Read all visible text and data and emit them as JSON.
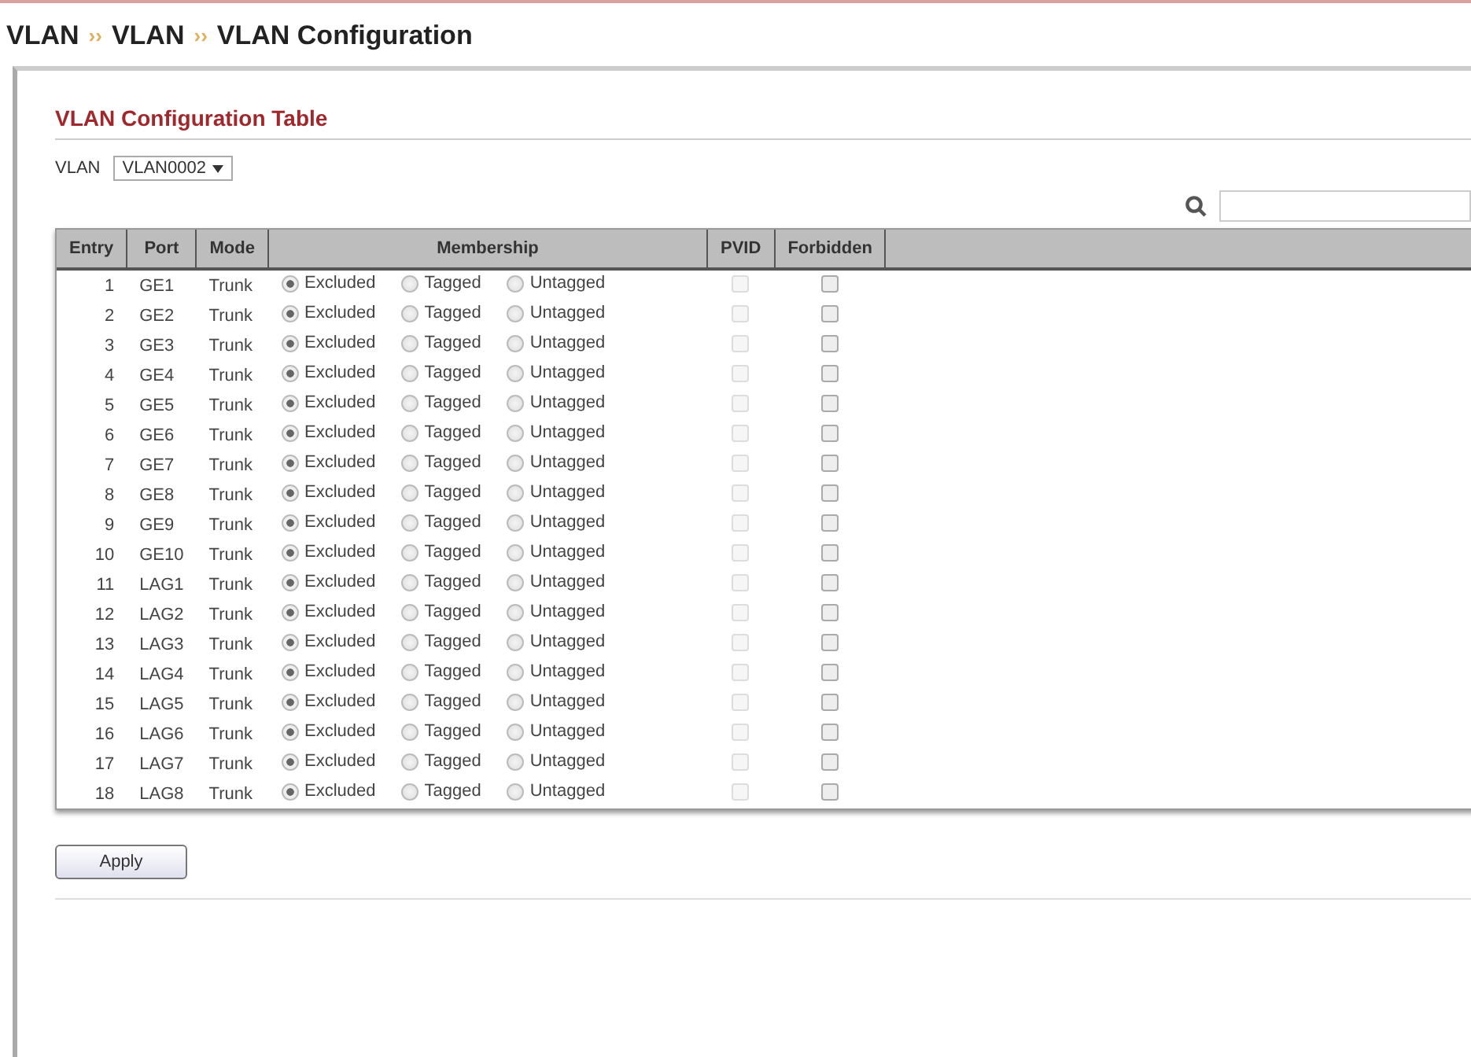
{
  "breadcrumb": [
    "VLAN",
    "VLAN",
    "VLAN Configuration"
  ],
  "breadcrumb_separator": "››",
  "section_title": "VLAN Configuration Table",
  "vlan_select": {
    "label": "VLAN",
    "value": "VLAN0002"
  },
  "table": {
    "columns": [
      "Entry",
      "Port",
      "Mode",
      "Membership",
      "PVID",
      "Forbidden"
    ],
    "rows": [
      {
        "entry": "1",
        "port": "GE1",
        "mode": "Trunk",
        "membership": [
          {
            "label": "Excluded",
            "selected": true
          },
          {
            "label": "Tagged",
            "selected": false
          },
          {
            "label": "Untagged",
            "selected": false
          }
        ],
        "pvid": {
          "checked": false,
          "disabled": true
        },
        "forbidden": {
          "checked": false
        }
      },
      {
        "entry": "2",
        "port": "GE2",
        "mode": "Trunk",
        "membership": [
          {
            "label": "Excluded",
            "selected": true
          },
          {
            "label": "Tagged",
            "selected": false
          },
          {
            "label": "Untagged",
            "selected": false
          }
        ],
        "pvid": {
          "checked": false,
          "disabled": true
        },
        "forbidden": {
          "checked": false
        }
      },
      {
        "entry": "3",
        "port": "GE3",
        "mode": "Trunk",
        "membership": [
          {
            "label": "Excluded",
            "selected": true
          },
          {
            "label": "Tagged",
            "selected": false
          },
          {
            "label": "Untagged",
            "selected": false
          }
        ],
        "pvid": {
          "checked": false,
          "disabled": true
        },
        "forbidden": {
          "checked": false
        }
      },
      {
        "entry": "4",
        "port": "GE4",
        "mode": "Trunk",
        "membership": [
          {
            "label": "Excluded",
            "selected": true
          },
          {
            "label": "Tagged",
            "selected": false
          },
          {
            "label": "Untagged",
            "selected": false
          }
        ],
        "pvid": {
          "checked": false,
          "disabled": true
        },
        "forbidden": {
          "checked": false
        }
      },
      {
        "entry": "5",
        "port": "GE5",
        "mode": "Trunk",
        "membership": [
          {
            "label": "Excluded",
            "selected": true
          },
          {
            "label": "Tagged",
            "selected": false
          },
          {
            "label": "Untagged",
            "selected": false
          }
        ],
        "pvid": {
          "checked": false,
          "disabled": true
        },
        "forbidden": {
          "checked": false
        }
      },
      {
        "entry": "6",
        "port": "GE6",
        "mode": "Trunk",
        "membership": [
          {
            "label": "Excluded",
            "selected": true
          },
          {
            "label": "Tagged",
            "selected": false
          },
          {
            "label": "Untagged",
            "selected": false
          }
        ],
        "pvid": {
          "checked": false,
          "disabled": true
        },
        "forbidden": {
          "checked": false
        }
      },
      {
        "entry": "7",
        "port": "GE7",
        "mode": "Trunk",
        "membership": [
          {
            "label": "Excluded",
            "selected": true
          },
          {
            "label": "Tagged",
            "selected": false
          },
          {
            "label": "Untagged",
            "selected": false
          }
        ],
        "pvid": {
          "checked": false,
          "disabled": true
        },
        "forbidden": {
          "checked": false
        }
      },
      {
        "entry": "8",
        "port": "GE8",
        "mode": "Trunk",
        "membership": [
          {
            "label": "Excluded",
            "selected": true
          },
          {
            "label": "Tagged",
            "selected": false
          },
          {
            "label": "Untagged",
            "selected": false
          }
        ],
        "pvid": {
          "checked": false,
          "disabled": true
        },
        "forbidden": {
          "checked": false
        }
      },
      {
        "entry": "9",
        "port": "GE9",
        "mode": "Trunk",
        "membership": [
          {
            "label": "Excluded",
            "selected": true
          },
          {
            "label": "Tagged",
            "selected": false
          },
          {
            "label": "Untagged",
            "selected": false
          }
        ],
        "pvid": {
          "checked": false,
          "disabled": true
        },
        "forbidden": {
          "checked": false
        }
      },
      {
        "entry": "10",
        "port": "GE10",
        "mode": "Trunk",
        "membership": [
          {
            "label": "Excluded",
            "selected": true
          },
          {
            "label": "Tagged",
            "selected": false
          },
          {
            "label": "Untagged",
            "selected": false
          }
        ],
        "pvid": {
          "checked": false,
          "disabled": true
        },
        "forbidden": {
          "checked": false
        }
      },
      {
        "entry": "11",
        "port": "LAG1",
        "mode": "Trunk",
        "membership": [
          {
            "label": "Excluded",
            "selected": true
          },
          {
            "label": "Tagged",
            "selected": false
          },
          {
            "label": "Untagged",
            "selected": false
          }
        ],
        "pvid": {
          "checked": false,
          "disabled": true
        },
        "forbidden": {
          "checked": false
        }
      },
      {
        "entry": "12",
        "port": "LAG2",
        "mode": "Trunk",
        "membership": [
          {
            "label": "Excluded",
            "selected": true
          },
          {
            "label": "Tagged",
            "selected": false
          },
          {
            "label": "Untagged",
            "selected": false
          }
        ],
        "pvid": {
          "checked": false,
          "disabled": true
        },
        "forbidden": {
          "checked": false
        }
      },
      {
        "entry": "13",
        "port": "LAG3",
        "mode": "Trunk",
        "membership": [
          {
            "label": "Excluded",
            "selected": true
          },
          {
            "label": "Tagged",
            "selected": false
          },
          {
            "label": "Untagged",
            "selected": false
          }
        ],
        "pvid": {
          "checked": false,
          "disabled": true
        },
        "forbidden": {
          "checked": false
        }
      },
      {
        "entry": "14",
        "port": "LAG4",
        "mode": "Trunk",
        "membership": [
          {
            "label": "Excluded",
            "selected": true
          },
          {
            "label": "Tagged",
            "selected": false
          },
          {
            "label": "Untagged",
            "selected": false
          }
        ],
        "pvid": {
          "checked": false,
          "disabled": true
        },
        "forbidden": {
          "checked": false
        }
      },
      {
        "entry": "15",
        "port": "LAG5",
        "mode": "Trunk",
        "membership": [
          {
            "label": "Excluded",
            "selected": true
          },
          {
            "label": "Tagged",
            "selected": false
          },
          {
            "label": "Untagged",
            "selected": false
          }
        ],
        "pvid": {
          "checked": false,
          "disabled": true
        },
        "forbidden": {
          "checked": false
        }
      },
      {
        "entry": "16",
        "port": "LAG6",
        "mode": "Trunk",
        "membership": [
          {
            "label": "Excluded",
            "selected": true
          },
          {
            "label": "Tagged",
            "selected": false
          },
          {
            "label": "Untagged",
            "selected": false
          }
        ],
        "pvid": {
          "checked": false,
          "disabled": true
        },
        "forbidden": {
          "checked": false
        }
      },
      {
        "entry": "17",
        "port": "LAG7",
        "mode": "Trunk",
        "membership": [
          {
            "label": "Excluded",
            "selected": true
          },
          {
            "label": "Tagged",
            "selected": false
          },
          {
            "label": "Untagged",
            "selected": false
          }
        ],
        "pvid": {
          "checked": false,
          "disabled": true
        },
        "forbidden": {
          "checked": false
        }
      },
      {
        "entry": "18",
        "port": "LAG8",
        "mode": "Trunk",
        "membership": [
          {
            "label": "Excluded",
            "selected": true
          },
          {
            "label": "Tagged",
            "selected": false
          },
          {
            "label": "Untagged",
            "selected": false
          }
        ],
        "pvid": {
          "checked": false,
          "disabled": true
        },
        "forbidden": {
          "checked": false
        }
      }
    ]
  },
  "buttons": [
    "Apply"
  ]
}
